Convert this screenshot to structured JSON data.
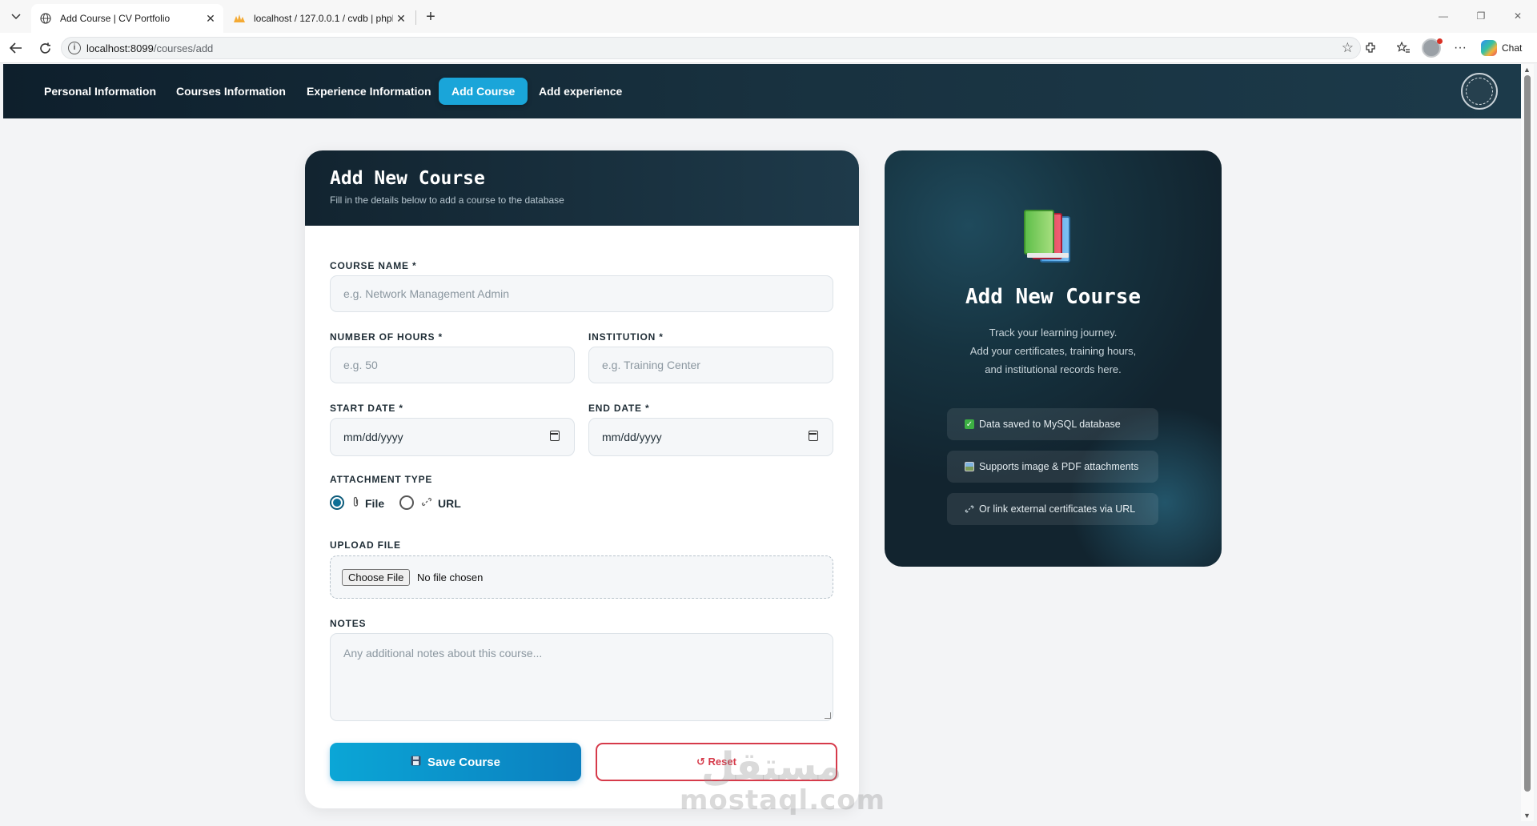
{
  "browser": {
    "tabs": [
      {
        "title": "Add Course | CV Portfolio",
        "active": true
      },
      {
        "title": "localhost / 127.0.0.1 / cvdb | phpM",
        "active": false
      }
    ],
    "url_host": "localhost:8099",
    "url_path": "/courses/add",
    "chat_label": "Chat"
  },
  "navbar": {
    "items": [
      {
        "label": "Personal Information",
        "active": false
      },
      {
        "label": "Courses Information",
        "active": false
      },
      {
        "label": "Experience Information",
        "active": false
      },
      {
        "label": "Add Course",
        "active": true
      },
      {
        "label": "Add experience",
        "active": false
      }
    ]
  },
  "form": {
    "title": "Add New Course",
    "subtitle": "Fill in the details below to add a course to the database",
    "course_name_label": "COURSE NAME *",
    "course_name_placeholder": "e.g. Network Management Admin",
    "hours_label": "NUMBER OF HOURS *",
    "hours_placeholder": "e.g. 50",
    "institution_label": "INSTITUTION *",
    "institution_placeholder": "e.g. Training Center",
    "start_date_label": "START DATE *",
    "start_date_value": "mm/dd/yyyy",
    "end_date_label": "END DATE *",
    "end_date_value": "mm/dd/yyyy",
    "attachment_label": "ATTACHMENT TYPE",
    "attachment_options": [
      {
        "label": "File",
        "icon": "paperclip-icon",
        "selected": true
      },
      {
        "label": "URL",
        "icon": "link-icon",
        "selected": false
      }
    ],
    "upload_label": "UPLOAD FILE",
    "choose_file_label": "Choose File",
    "no_file_text": "No file chosen",
    "notes_label": "NOTES",
    "notes_placeholder": "Any additional notes about this course...",
    "save_label": "Save Course",
    "reset_label": "↺ Reset",
    "colors": {
      "primary": "#0ba6d6",
      "danger": "#d63a4a",
      "header_dark": "#122430"
    }
  },
  "side_panel": {
    "title": "Add New Course",
    "text_lines": [
      "Track your learning journey.",
      "Add your certificates, training hours,",
      "and institutional records here."
    ],
    "features": [
      {
        "icon": "check-icon",
        "text": "Data saved to MySQL database"
      },
      {
        "icon": "image-icon",
        "text": "Supports image & PDF attachments"
      },
      {
        "icon": "link-icon",
        "text": "Or link external certificates via URL"
      }
    ]
  },
  "watermark": {
    "latin": "mostaql.com",
    "arabic": "مستقل"
  }
}
